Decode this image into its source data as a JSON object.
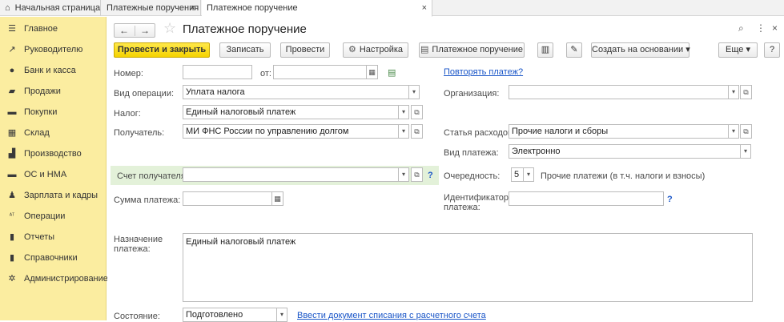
{
  "tabs": {
    "home_label": "Начальная страница",
    "tab1_label": "Платежные поручения",
    "tab2_label": "Платежное поручение",
    "close_glyph": "×"
  },
  "sidebar": {
    "items": [
      {
        "label": "Главное",
        "icon": "menu-icon",
        "glyph": "☰"
      },
      {
        "label": "Руководителю",
        "icon": "trend-icon",
        "glyph": "↗"
      },
      {
        "label": "Банк и касса",
        "icon": "coin-icon",
        "glyph": "●"
      },
      {
        "label": "Продажи",
        "icon": "bag-icon",
        "glyph": "▰"
      },
      {
        "label": "Покупки",
        "icon": "cart-icon",
        "glyph": "▬"
      },
      {
        "label": "Склад",
        "icon": "warehouse-icon",
        "glyph": "▦"
      },
      {
        "label": "Производство",
        "icon": "factory-icon",
        "glyph": "▟"
      },
      {
        "label": "ОС и НМА",
        "icon": "truck-icon",
        "glyph": "▬"
      },
      {
        "label": "Зарплата и кадры",
        "icon": "person-icon",
        "glyph": "♟"
      },
      {
        "label": "Операции",
        "icon": "operations-icon",
        "glyph": "ᴬᵀ"
      },
      {
        "label": "Отчеты",
        "icon": "bar-chart-icon",
        "glyph": "▮"
      },
      {
        "label": "Справочники",
        "icon": "book-icon",
        "glyph": "▮"
      },
      {
        "label": "Администрирование",
        "icon": "gear-icon",
        "glyph": "✲"
      }
    ]
  },
  "header": {
    "title": "Платежное поручение",
    "back_glyph": "←",
    "forward_glyph": "→",
    "star_glyph": "☆",
    "link_glyph": "⌕",
    "more_glyph": "⋮",
    "close_glyph": "×"
  },
  "toolbar": {
    "post_close": "Провести и закрыть",
    "save": "Записать",
    "post": "Провести",
    "settings": "Настройка",
    "payment_order": "Платежное поручение",
    "create_based": "Создать на основании",
    "more": "Еще",
    "help": "?",
    "settings_glyph": "⚙",
    "printer_glyph": "▤",
    "doc_glyph": "▥",
    "clip_glyph": "✎",
    "dd_glyph": "▾"
  },
  "form": {
    "number_label": "Номер:",
    "number_value": "",
    "date_label": "от:",
    "date_value": "",
    "repeat_link": "Повторять платеж?",
    "operation_label": "Вид операции:",
    "operation_value": "Уплата налога",
    "org_label": "Организация:",
    "org_value": "",
    "tax_label": "Налог:",
    "tax_value": "Единый налоговый платеж",
    "recipient_label": "Получатель:",
    "recipient_value": "МИ ФНС России по управлению долгом",
    "expense_label": "Статья расходов:",
    "expense_value": "Прочие налоги и сборы",
    "payment_type_label": "Вид платежа:",
    "payment_type_value": "Электронно",
    "account_label": "Счет получателя:",
    "account_value": "",
    "priority_label": "Очередность:",
    "priority_value": "5",
    "priority_desc": "Прочие платежи (в т.ч. налоги и взносы)",
    "amount_label": "Сумма платежа:",
    "amount_value": "",
    "identifier_label_1": "Идентификатор",
    "identifier_label_2": "платежа:",
    "identifier_value": "",
    "purpose_label_1": "Назначение",
    "purpose_label_2": "платежа:",
    "purpose_value": "Единый налоговый платеж",
    "state_label": "Состояние:",
    "state_value": "Подготовлено",
    "writeoff_link": "Ввести документ списания с расчетного счета",
    "help_q": "?",
    "open_glyph": "⧉",
    "dd_glyph": "▾",
    "calendar_glyph": "▦"
  }
}
